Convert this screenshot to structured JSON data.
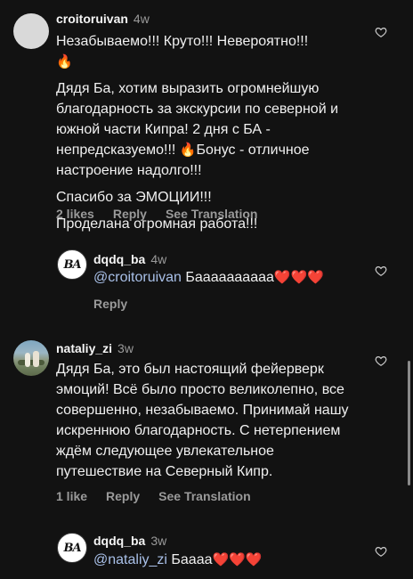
{
  "comments": [
    {
      "username": "croitoruivan",
      "time": "4w",
      "paragraphs": [
        "Незабываемо!!! Круто!!! Невероятно!!!",
        "Дядя Ба, хотим выразить огромнейшую благодарность за экскурсии по северной и южной части Кипра! 2 дня с БА - непредсказуемо!!!",
        "Бонус - отличное настроение надолго!!!",
        "Спасибо за ЭМОЦИИ!!!",
        "Проделана огромная работа!!!"
      ],
      "likes": "2 likes",
      "reply": "Reply",
      "translate": "See Translation"
    },
    {
      "username": "dqdq_ba",
      "time": "4w",
      "mention": "@croitoruivan",
      "text": "Баааааааааа",
      "reply": "Reply",
      "logo": "BA"
    },
    {
      "username": "nataliy_zi",
      "time": "3w",
      "text": "Дядя Ба, это был настоящий фейерверк эмоций! Всё было просто великолепно, все совершенно, незабываемо. Принимай нашу искреннюю благодарность. С нетерпением ждём следующее увлекательное путешествие на Северный Кипр.",
      "likes": "1 like",
      "reply": "Reply",
      "translate": "See Translation"
    },
    {
      "username": "dqdq_ba",
      "time": "3w",
      "mention": "@nataliy_zi",
      "text": "Баааа",
      "logo": "BA"
    }
  ],
  "emoji": {
    "fire": "🔥",
    "heart": "❤️"
  },
  "colors": {
    "background": "#121212",
    "mention": "#a9c0e8",
    "muted": "#9a9a9a"
  }
}
